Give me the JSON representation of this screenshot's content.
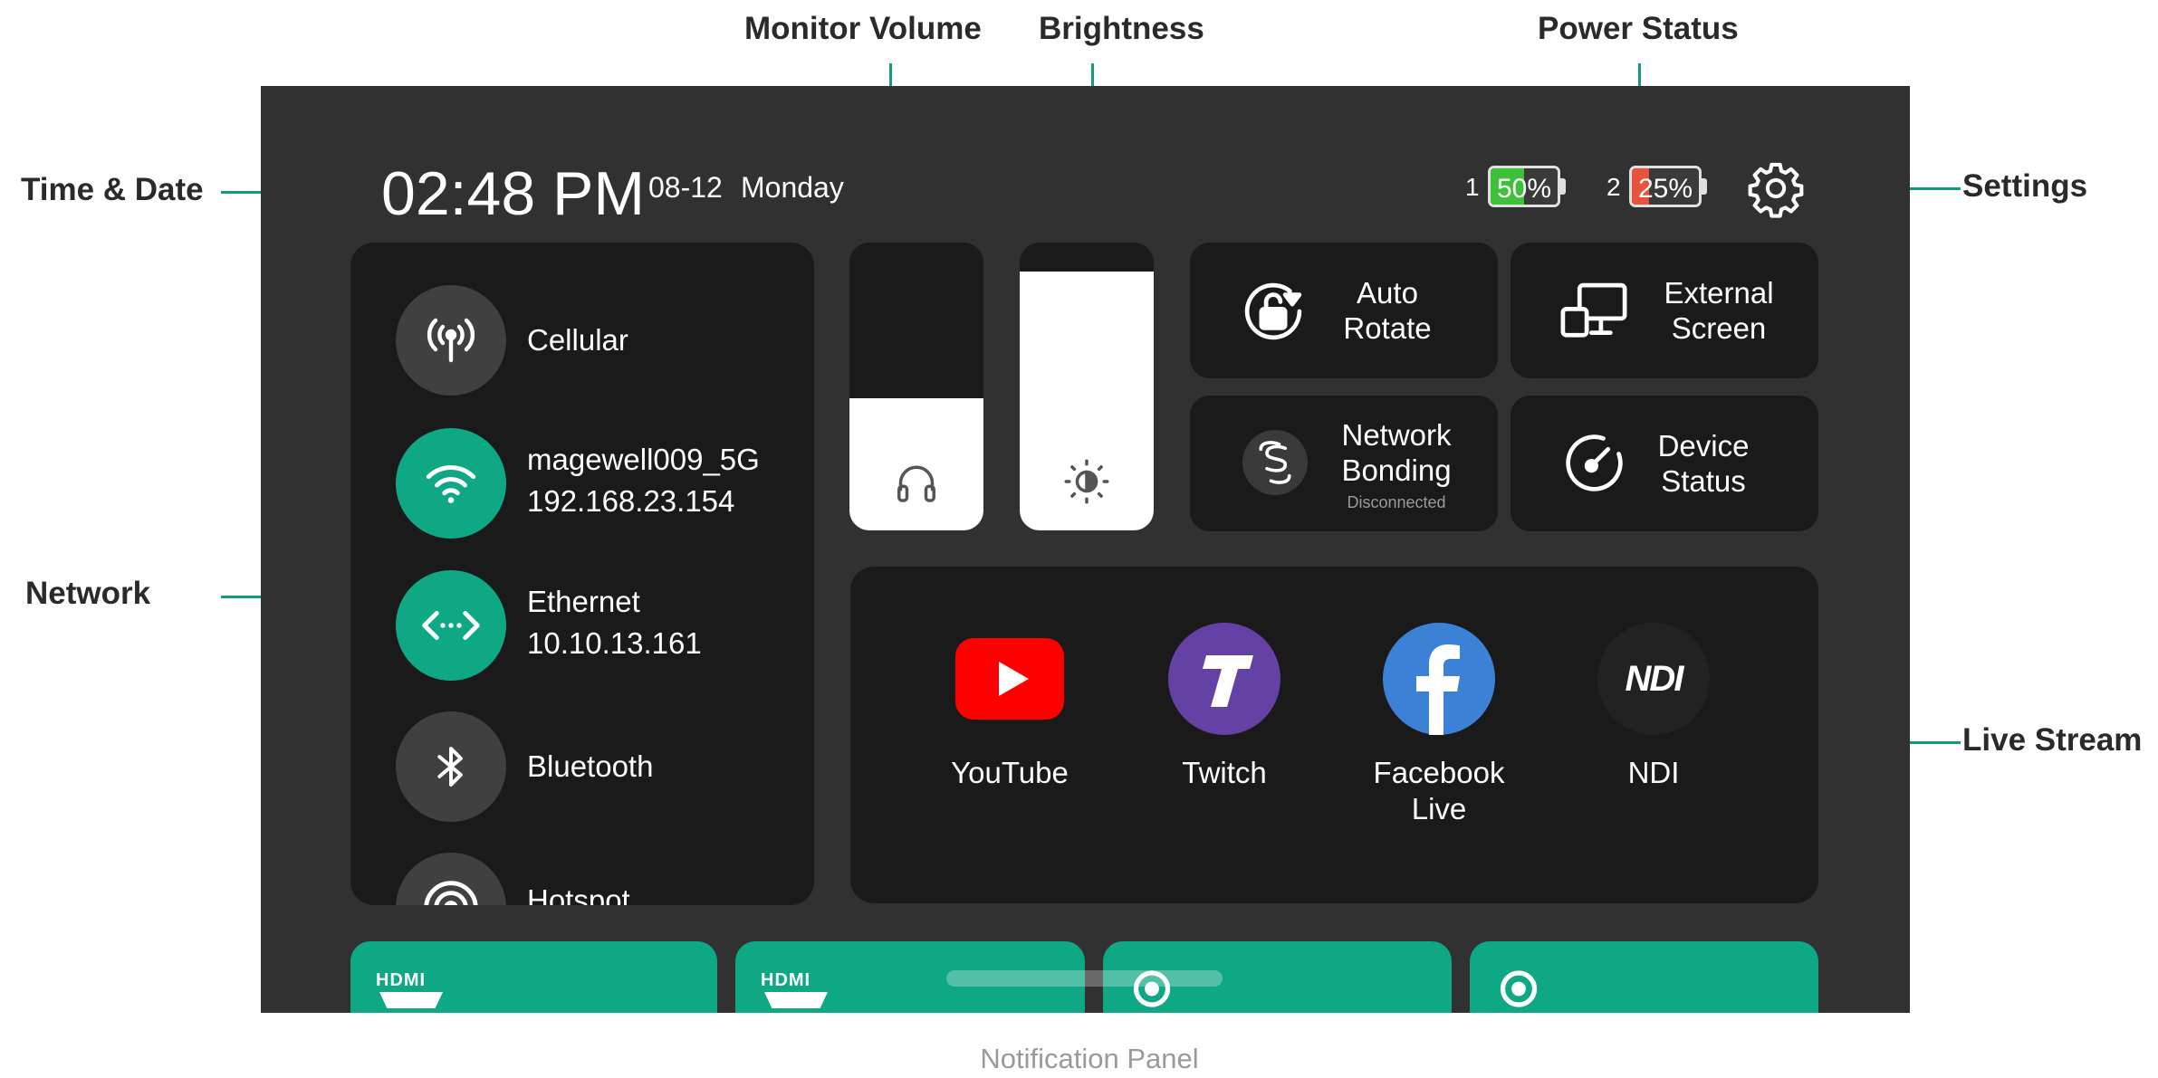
{
  "annotations": {
    "time_date": "Time & Date",
    "network": "Network",
    "monitor_volume": "Monitor Volume",
    "brightness": "Brightness",
    "power_status": "Power Status",
    "settings": "Settings",
    "live_stream": "Live Stream",
    "notification_panel": "Notification Panel"
  },
  "status_bar": {
    "time": "02:48 PM",
    "date": "08-12",
    "weekday": "Monday",
    "batteries": [
      {
        "index": "1",
        "percent": "50%",
        "level": 0.5,
        "color": "#3ec03a"
      },
      {
        "index": "2",
        "percent": "25%",
        "level": 0.25,
        "color": "#e8533f"
      }
    ],
    "settings_icon": "gear-icon"
  },
  "network": {
    "items": [
      {
        "label": "Cellular",
        "detail": "",
        "icon": "cellular-antenna-icon",
        "active": false
      },
      {
        "label": "magewell009_5G",
        "detail": "192.168.23.154",
        "icon": "wifi-icon",
        "active": true
      },
      {
        "label": "Ethernet",
        "detail": "10.10.13.161",
        "icon": "ethernet-icon",
        "active": true
      },
      {
        "label": "Bluetooth",
        "detail": "",
        "icon": "bluetooth-icon",
        "active": false
      },
      {
        "label": "Hotspot",
        "detail": "",
        "icon": "hotspot-icon",
        "active": false
      }
    ]
  },
  "sliders": {
    "volume": {
      "level": 0.46,
      "icon": "headphones-icon"
    },
    "brightness": {
      "level": 0.9,
      "icon": "brightness-icon"
    }
  },
  "tiles": {
    "auto_rotate": {
      "line1": "Auto",
      "line2": "Rotate",
      "icon": "rotate-lock-icon"
    },
    "external_screen": {
      "line1": "External",
      "line2": "Screen",
      "icon": "external-screen-icon"
    },
    "network_bonding": {
      "line1": "Network",
      "line2": "Bonding",
      "status": "Disconnected",
      "icon": "bonding-icon"
    },
    "device_status": {
      "line1": "Device",
      "line2": "Status",
      "icon": "gauge-icon"
    }
  },
  "live_stream": {
    "services": [
      {
        "label": "YouTube",
        "icon": "youtube-icon",
        "color": "#ff0000"
      },
      {
        "label": "Twitch",
        "icon": "twitch-icon",
        "color": "#6441a5"
      },
      {
        "label": "Facebook Live",
        "icon": "facebook-icon",
        "color": "#3b82d6"
      },
      {
        "label": "NDI",
        "icon": "ndi-icon",
        "color": "#222222",
        "logo_text": "NDI"
      }
    ]
  },
  "sources": {
    "items": [
      {
        "icon": "hdmi-icon",
        "logo_text": "HDMI"
      },
      {
        "icon": "hdmi-icon",
        "logo_text": "HDMI"
      },
      {
        "icon": "webcam-icon"
      },
      {
        "icon": "webcam-icon"
      }
    ]
  },
  "colors": {
    "accent": "#119a7c",
    "active_green": "#0ea884",
    "screen_bg": "#313131",
    "panel_bg": "#1a1a1a"
  }
}
